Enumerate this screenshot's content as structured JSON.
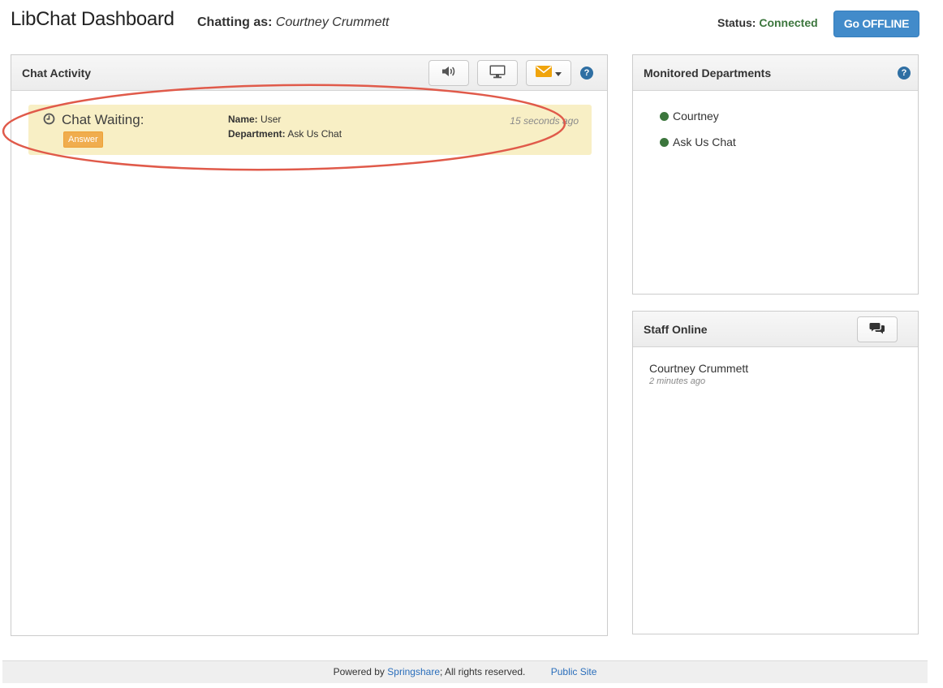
{
  "header": {
    "title": "LibChat Dashboard",
    "chatting_as_label": "Chatting as:",
    "chatting_as_name": "Courtney Crummett",
    "status_label": "Status:",
    "status_value": "Connected",
    "go_offline_label": "Go OFFLINE"
  },
  "chat_activity": {
    "title": "Chat Activity",
    "tools": [
      {
        "icon": "volume-icon"
      },
      {
        "icon": "desktop-icon"
      },
      {
        "icon": "envelope-icon",
        "dropdown": true
      }
    ],
    "help": "?",
    "items": [
      {
        "status": "Chat Waiting:",
        "answer_label": "Answer",
        "name_label": "Name:",
        "name_value": "User",
        "dept_label": "Department:",
        "dept_value": "Ask Us Chat",
        "time": "15 seconds ago"
      }
    ]
  },
  "monitored_departments": {
    "title": "Monitored Departments",
    "help": "?",
    "items": [
      {
        "label": "Courtney",
        "status_color": "#3c763d"
      },
      {
        "label": "Ask Us Chat",
        "status_color": "#3c763d"
      }
    ]
  },
  "staff_online": {
    "title": "Staff Online",
    "tool_icon": "comments-icon",
    "staff": [
      {
        "name": "Courtney Crummett",
        "last_seen": "2 minutes ago"
      }
    ]
  },
  "footer": {
    "powered_by": "Powered by",
    "springshare_link": "Springshare",
    "rights": "; All rights reserved.",
    "public_site_link": "Public Site"
  },
  "colors": {
    "accent": "#428bca",
    "connected": "#3c763d",
    "waiting_bg": "#f8efc5",
    "answer": "#f0ad4e",
    "envelope": "#f0a40c",
    "annotation": "#e05a4a"
  }
}
